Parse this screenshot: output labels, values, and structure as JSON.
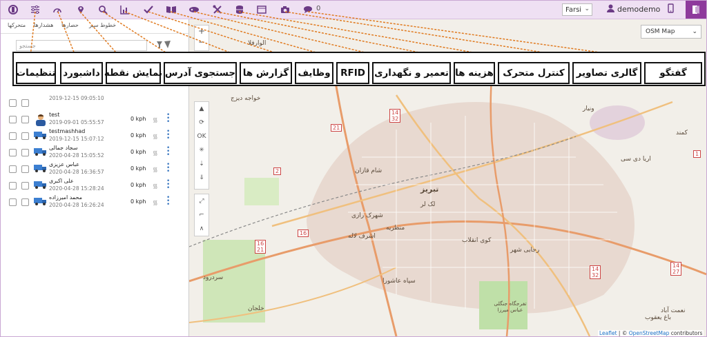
{
  "toolbar": {
    "icons": [
      "logo-icon",
      "settings-icon",
      "dashboard-icon",
      "point-display-icon",
      "search-icon",
      "reports-icon",
      "tasks-icon",
      "rfid-icon",
      "maintenance-icon",
      "costs-icon",
      "vehicle-control-icon",
      "gallery-icon",
      "chat-icon"
    ],
    "chat_count": "0",
    "language": "Farsi",
    "username": "demodemo"
  },
  "left_panel": {
    "tabs": [
      "متحرکها",
      "هشدارها",
      "حصارها",
      "خطوط سیر"
    ],
    "search_placeholder": "جستجو",
    "vehicles": [
      {
        "name": "",
        "date": "2019-12-15 09:05:10",
        "speed": "",
        "type": "truck"
      },
      {
        "name": "test",
        "date": "2019-09-01 05:55:57",
        "speed": "0 kph",
        "type": "person"
      },
      {
        "name": "testmashhad",
        "date": "2019-12-15 15:07:12",
        "speed": "0 kph",
        "type": "truck"
      },
      {
        "name": "سجاد جمالی",
        "date": "2020-04-28 15:05:52",
        "speed": "0 kph",
        "type": "truck"
      },
      {
        "name": "عباس عزیزی",
        "date": "2020-04-28 16:36:57",
        "speed": "0 kph",
        "type": "truck"
      },
      {
        "name": "علی اکبری",
        "date": "2020-04-28 15:28:24",
        "speed": "0 kph",
        "type": "truck"
      },
      {
        "name": "محمد امیرزاده",
        "date": "2020-04-28 16:26:24",
        "speed": "0 kph",
        "type": "truck"
      }
    ]
  },
  "map": {
    "layer": "OSM Map",
    "attribution_leaflet": "Leaflet",
    "attribution_osm": "OpenStreetMap",
    "attribution_suffix": "contributors",
    "labels": {
      "tabriz": "تبریز",
      "sardrood": "سردرود",
      "khalajan": "خلجان",
      "shahrak_razi": "شهرک رازی",
      "ashrafabad": "اشرف لاله",
      "koy_enghelab": "کوی انقلاب",
      "rajaei_shahr": "رجایی شهر",
      "sepah": "سپاه عاشورا",
      "jangal": "تفرجگاه جنگلی عباس میرزا",
      "baghmisheh": "باغ یعقوب",
      "valiabad": "ونیار",
      "kamand": "کمند",
      "arya": "اریا دی سی",
      "nemat": "نعمت آباد",
      "lakle": "لک لر",
      "shamghazan": "شام قازان",
      "monjazzeh": "منظریه",
      "khajeh": "خواجه دیزج",
      "alvar": "الوارفلا"
    },
    "shields": [
      "14\n32",
      "21",
      "2",
      "16",
      "16\n21",
      "14\n27",
      "14\n32",
      "1"
    ]
  },
  "annotations": {
    "settings": "تنظیمات",
    "dashboard": "داشبورد",
    "point_display": "نمایش نقطه",
    "address_search": "جستجوی آدرس",
    "reports": "گزارش ها",
    "tasks": "وظایف",
    "rfid": "RFID",
    "maintenance": "تعمیر و نگهداری",
    "costs": "هزینه ها",
    "vehicle_control": "کنترل متحرک",
    "gallery": "گالری تصاویر",
    "chat": "گفتگو"
  }
}
